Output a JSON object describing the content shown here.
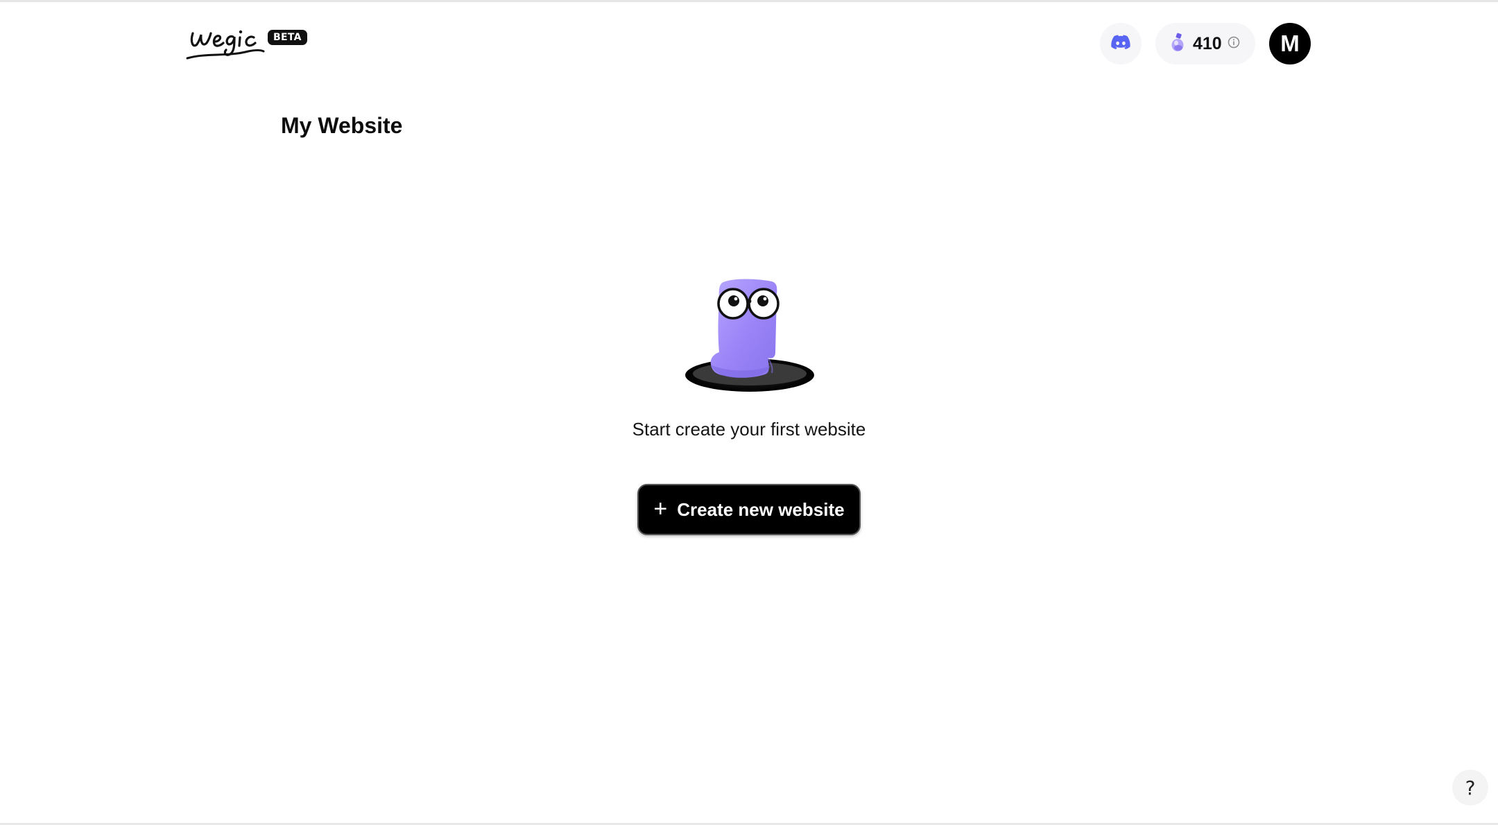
{
  "header": {
    "logo_text": "wegic",
    "beta_label": "BETA",
    "discord_icon": "discord-icon",
    "credits": {
      "icon": "potion-icon",
      "value": "410",
      "info_icon": "info-icon"
    },
    "avatar_initial": "M"
  },
  "page": {
    "title": "My Website"
  },
  "empty_state": {
    "illustration": "mascot-illustration",
    "message": "Start create your first website",
    "create_button_label": "Create new website",
    "create_button_icon": "plus-icon"
  },
  "help": {
    "label": "?"
  },
  "colors": {
    "accent_purple": "#9b87f5",
    "discord_blue": "#5865f2",
    "button_bg": "#000000"
  }
}
